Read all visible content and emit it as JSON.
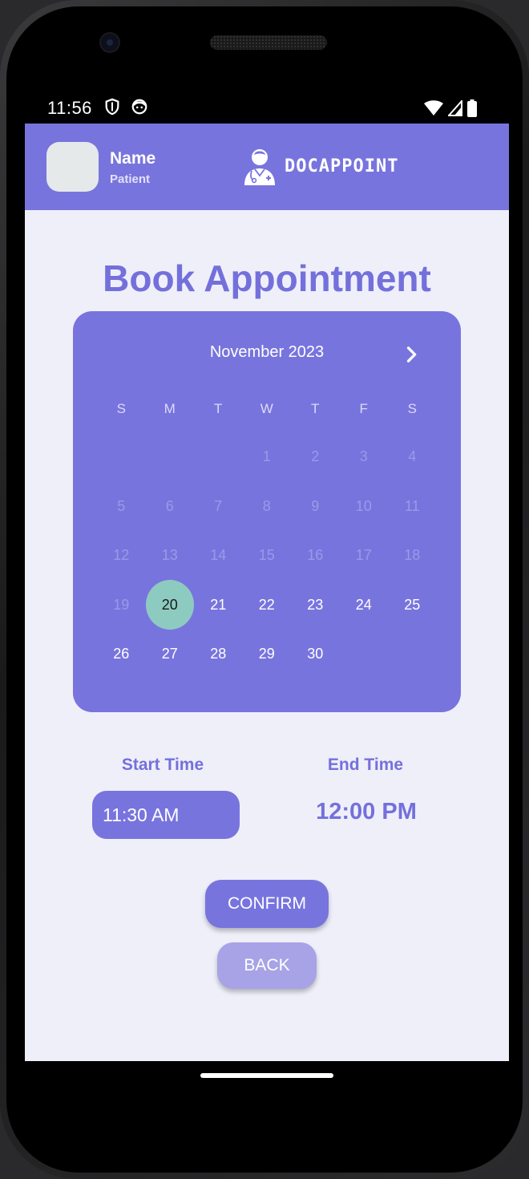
{
  "status_bar": {
    "time": "11:56"
  },
  "header": {
    "user_name": "Name",
    "user_role": "Patient",
    "brand": "DOCAPPOINT"
  },
  "page": {
    "title": "Book Appointment"
  },
  "calendar": {
    "month_label": "November 2023",
    "weekdays": [
      "S",
      "M",
      "T",
      "W",
      "T",
      "F",
      "S"
    ],
    "selected_day": "20",
    "days": [
      {
        "label": "",
        "state": "empty"
      },
      {
        "label": "",
        "state": "empty"
      },
      {
        "label": "",
        "state": "empty"
      },
      {
        "label": "1",
        "state": "disabled"
      },
      {
        "label": "2",
        "state": "disabled"
      },
      {
        "label": "3",
        "state": "disabled"
      },
      {
        "label": "4",
        "state": "disabled"
      },
      {
        "label": "5",
        "state": "disabled"
      },
      {
        "label": "6",
        "state": "disabled"
      },
      {
        "label": "7",
        "state": "disabled"
      },
      {
        "label": "8",
        "state": "disabled"
      },
      {
        "label": "9",
        "state": "disabled"
      },
      {
        "label": "10",
        "state": "disabled"
      },
      {
        "label": "11",
        "state": "disabled"
      },
      {
        "label": "12",
        "state": "disabled"
      },
      {
        "label": "13",
        "state": "disabled"
      },
      {
        "label": "14",
        "state": "disabled"
      },
      {
        "label": "15",
        "state": "disabled"
      },
      {
        "label": "16",
        "state": "disabled"
      },
      {
        "label": "17",
        "state": "disabled"
      },
      {
        "label": "18",
        "state": "disabled"
      },
      {
        "label": "19",
        "state": "disabled"
      },
      {
        "label": "20",
        "state": "selected"
      },
      {
        "label": "21",
        "state": "enabled"
      },
      {
        "label": "22",
        "state": "enabled"
      },
      {
        "label": "23",
        "state": "enabled"
      },
      {
        "label": "24",
        "state": "enabled"
      },
      {
        "label": "25",
        "state": "enabled"
      },
      {
        "label": "26",
        "state": "enabled"
      },
      {
        "label": "27",
        "state": "enabled"
      },
      {
        "label": "28",
        "state": "enabled"
      },
      {
        "label": "29",
        "state": "enabled"
      },
      {
        "label": "30",
        "state": "enabled"
      }
    ]
  },
  "time": {
    "start_label": "Start Time",
    "start_value": "11:30 AM",
    "end_label": "End Time",
    "end_value": "12:00 PM"
  },
  "actions": {
    "confirm_label": "CONFIRM",
    "back_label": "BACK"
  },
  "colors": {
    "primary": "#7874de",
    "primary_light": "#a7a3e6",
    "selected_day": "#8dcbc0",
    "background": "#efeffa",
    "title_text": "#7470db"
  },
  "icons": {
    "next_month": "chevron-right-icon",
    "brand": "doctor-icon",
    "status_left": [
      "shield-icon",
      "face-icon"
    ],
    "status_right": [
      "wifi-icon",
      "signal-icon",
      "battery-icon"
    ]
  }
}
